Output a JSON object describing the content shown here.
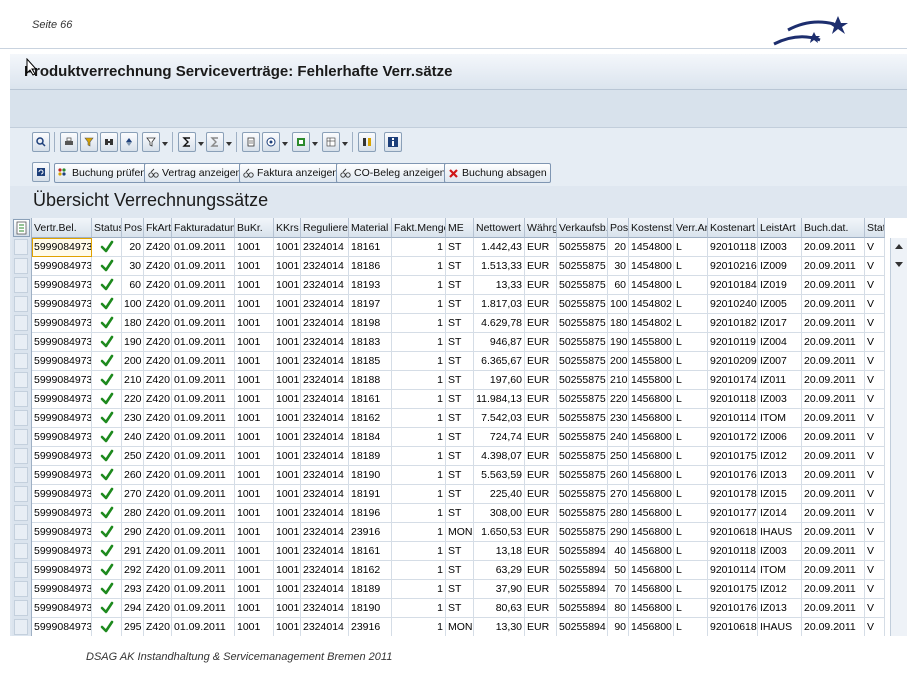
{
  "slide": {
    "page_label": "Seite 66",
    "footer": "DSAG AK Instandhaltung & Servicemanagement Bremen 2011",
    "logo_icon": "dsag-stars-logo"
  },
  "window": {
    "title": "Produktverrechnung Serviceverträge: Fehlerhafte Verr.sätze"
  },
  "toolbar": {
    "icons": [
      "details-icon",
      "print-icon",
      "filter-icon",
      "find-icon",
      "set-filter-icon",
      "sum-icon",
      "subtotal-icon",
      "print-preview-icon",
      "export-icon",
      "views-icon",
      "layout-icon",
      "column-icon",
      "info-icon"
    ]
  },
  "buttons": {
    "refresh_icon": "refresh-icon",
    "check_posting": "Buchung prüfen",
    "show_contract": "Vertrag anzeigen",
    "show_invoice": "Faktura anzeigen",
    "show_co_doc": "CO-Beleg anzeigen",
    "cancel_posting": "Buchung absagen"
  },
  "section": {
    "title": "Übersicht Verrechnungssätze"
  },
  "table": {
    "columns": [
      "Vertr.Bel.",
      "Status",
      "Pos",
      "FkArt",
      "Fakturadatum",
      "BuKr.",
      "KKrs",
      "Regulierer",
      "Material",
      "Fakt.Menge",
      "ME",
      "Nettowert",
      "Währg",
      "Verkaufsb.",
      "Pos",
      "Kostenst.",
      "Verr.Art",
      "Kostenart",
      "LeistArt",
      "Buch.dat.",
      "Stat"
    ],
    "status_icon": "green-checkmark-icon",
    "rows": [
      [
        "5999084973",
        "",
        "20",
        "Z420",
        "01.09.2011",
        "1001",
        "1001",
        "2324014",
        "18161",
        "1",
        "ST",
        "1.442,43",
        "EUR",
        "50255875",
        "20",
        "1454800",
        "L",
        "92010118",
        "IZ003",
        "20.09.2011",
        "V"
      ],
      [
        "5999084973",
        "",
        "30",
        "Z420",
        "01.09.2011",
        "1001",
        "1001",
        "2324014",
        "18186",
        "1",
        "ST",
        "1.513,33",
        "EUR",
        "50255875",
        "30",
        "1454800",
        "L",
        "92010216",
        "IZ009",
        "20.09.2011",
        "V"
      ],
      [
        "5999084973",
        "",
        "60",
        "Z420",
        "01.09.2011",
        "1001",
        "1001",
        "2324014",
        "18193",
        "1",
        "ST",
        "13,33",
        "EUR",
        "50255875",
        "60",
        "1454800",
        "L",
        "92010184",
        "IZ019",
        "20.09.2011",
        "V"
      ],
      [
        "5999084973",
        "",
        "100",
        "Z420",
        "01.09.2011",
        "1001",
        "1001",
        "2324014",
        "18197",
        "1",
        "ST",
        "1.817,03",
        "EUR",
        "50255875",
        "100",
        "1454802",
        "L",
        "92010240",
        "IZ005",
        "20.09.2011",
        "V"
      ],
      [
        "5999084973",
        "",
        "180",
        "Z420",
        "01.09.2011",
        "1001",
        "1001",
        "2324014",
        "18198",
        "1",
        "ST",
        "4.629,78",
        "EUR",
        "50255875",
        "180",
        "1454802",
        "L",
        "92010182",
        "IZ017",
        "20.09.2011",
        "V"
      ],
      [
        "5999084973",
        "",
        "190",
        "Z420",
        "01.09.2011",
        "1001",
        "1001",
        "2324014",
        "18183",
        "1",
        "ST",
        "946,87",
        "EUR",
        "50255875",
        "190",
        "1455800",
        "L",
        "92010119",
        "IZ004",
        "20.09.2011",
        "V"
      ],
      [
        "5999084973",
        "",
        "200",
        "Z420",
        "01.09.2011",
        "1001",
        "1001",
        "2324014",
        "18185",
        "1",
        "ST",
        "6.365,67",
        "EUR",
        "50255875",
        "200",
        "1455800",
        "L",
        "92010209",
        "IZ007",
        "20.09.2011",
        "V"
      ],
      [
        "5999084973",
        "",
        "210",
        "Z420",
        "01.09.2011",
        "1001",
        "1001",
        "2324014",
        "18188",
        "1",
        "ST",
        "197,60",
        "EUR",
        "50255875",
        "210",
        "1455800",
        "L",
        "92010174",
        "IZ011",
        "20.09.2011",
        "V"
      ],
      [
        "5999084973",
        "",
        "220",
        "Z420",
        "01.09.2011",
        "1001",
        "1001",
        "2324014",
        "18161",
        "1",
        "ST",
        "11.984,13",
        "EUR",
        "50255875",
        "220",
        "1456800",
        "L",
        "92010118",
        "IZ003",
        "20.09.2011",
        "V"
      ],
      [
        "5999084973",
        "",
        "230",
        "Z420",
        "01.09.2011",
        "1001",
        "1001",
        "2324014",
        "18162",
        "1",
        "ST",
        "7.542,03",
        "EUR",
        "50255875",
        "230",
        "1456800",
        "L",
        "92010114",
        "ITOM",
        "20.09.2011",
        "V"
      ],
      [
        "5999084973",
        "",
        "240",
        "Z420",
        "01.09.2011",
        "1001",
        "1001",
        "2324014",
        "18184",
        "1",
        "ST",
        "724,74",
        "EUR",
        "50255875",
        "240",
        "1456800",
        "L",
        "92010172",
        "IZ006",
        "20.09.2011",
        "V"
      ],
      [
        "5999084973",
        "",
        "250",
        "Z420",
        "01.09.2011",
        "1001",
        "1001",
        "2324014",
        "18189",
        "1",
        "ST",
        "4.398,07",
        "EUR",
        "50255875",
        "250",
        "1456800",
        "L",
        "92010175",
        "IZ012",
        "20.09.2011",
        "V"
      ],
      [
        "5999084973",
        "",
        "260",
        "Z420",
        "01.09.2011",
        "1001",
        "1001",
        "2324014",
        "18190",
        "1",
        "ST",
        "5.563,59",
        "EUR",
        "50255875",
        "260",
        "1456800",
        "L",
        "92010176",
        "IZ013",
        "20.09.2011",
        "V"
      ],
      [
        "5999084973",
        "",
        "270",
        "Z420",
        "01.09.2011",
        "1001",
        "1001",
        "2324014",
        "18191",
        "1",
        "ST",
        "225,40",
        "EUR",
        "50255875",
        "270",
        "1456800",
        "L",
        "92010178",
        "IZ015",
        "20.09.2011",
        "V"
      ],
      [
        "5999084973",
        "",
        "280",
        "Z420",
        "01.09.2011",
        "1001",
        "1001",
        "2324014",
        "18196",
        "1",
        "ST",
        "308,00",
        "EUR",
        "50255875",
        "280",
        "1456800",
        "L",
        "92010177",
        "IZ014",
        "20.09.2011",
        "V"
      ],
      [
        "5999084973",
        "",
        "290",
        "Z420",
        "01.09.2011",
        "1001",
        "1001",
        "2324014",
        "23916",
        "1",
        "MON",
        "1.650,53",
        "EUR",
        "50255875",
        "290",
        "1456800",
        "L",
        "92010618",
        "IHAUS",
        "20.09.2011",
        "V"
      ],
      [
        "5999084973",
        "",
        "291",
        "Z420",
        "01.09.2011",
        "1001",
        "1001",
        "2324014",
        "18161",
        "1",
        "ST",
        "13,18",
        "EUR",
        "50255894",
        "40",
        "1456800",
        "L",
        "92010118",
        "IZ003",
        "20.09.2011",
        "V"
      ],
      [
        "5999084973",
        "",
        "292",
        "Z420",
        "01.09.2011",
        "1001",
        "1001",
        "2324014",
        "18162",
        "1",
        "ST",
        "63,29",
        "EUR",
        "50255894",
        "50",
        "1456800",
        "L",
        "92010114",
        "ITOM",
        "20.09.2011",
        "V"
      ],
      [
        "5999084973",
        "",
        "293",
        "Z420",
        "01.09.2011",
        "1001",
        "1001",
        "2324014",
        "18189",
        "1",
        "ST",
        "37,90",
        "EUR",
        "50255894",
        "70",
        "1456800",
        "L",
        "92010175",
        "IZ012",
        "20.09.2011",
        "V"
      ],
      [
        "5999084973",
        "",
        "294",
        "Z420",
        "01.09.2011",
        "1001",
        "1001",
        "2324014",
        "18190",
        "1",
        "ST",
        "80,63",
        "EUR",
        "50255894",
        "80",
        "1456800",
        "L",
        "92010176",
        "IZ013",
        "20.09.2011",
        "V"
      ],
      [
        "5999084973",
        "",
        "295",
        "Z420",
        "01.09.2011",
        "1001",
        "1001",
        "2324014",
        "23916",
        "1",
        "MON",
        "13,30",
        "EUR",
        "50255894",
        "90",
        "1456800",
        "L",
        "92010618",
        "IHAUS",
        "20.09.2011",
        "V"
      ]
    ]
  },
  "colors": {
    "accent_navy": "#1d2e6e",
    "check_green": "#1e8a1e",
    "focus_outline": "#e0a200",
    "frame_blue": "#dfe7f0"
  }
}
